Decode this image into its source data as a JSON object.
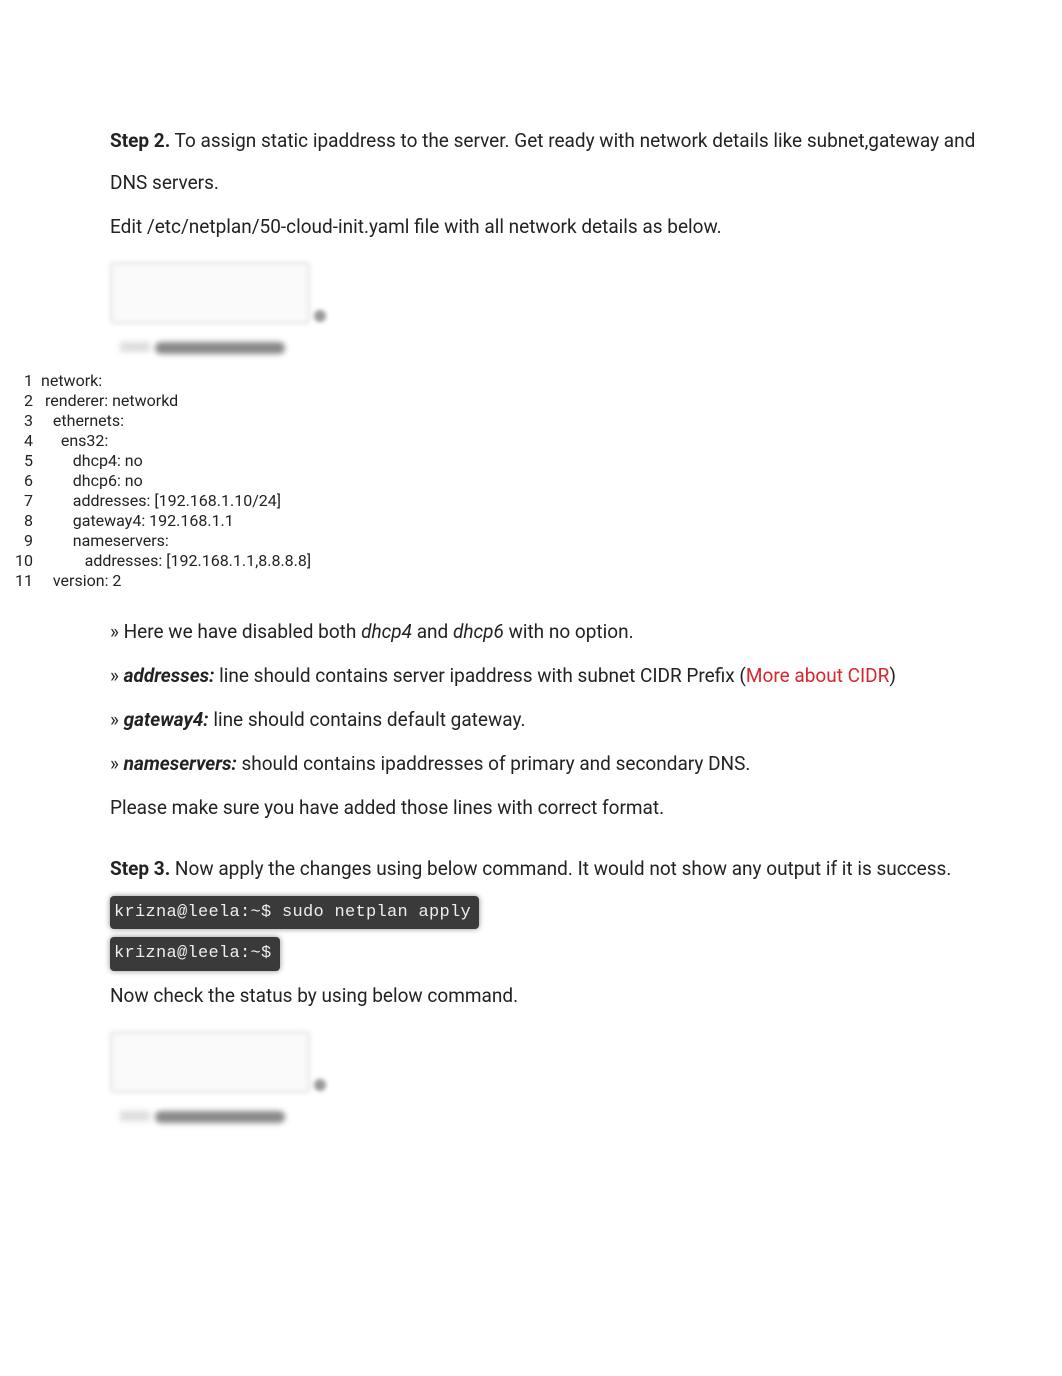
{
  "step2": {
    "label": "Step 2.",
    "para1": " To assign static ipaddress to the server. Get ready with network details like subnet,gateway and DNS servers.",
    "para2": "Edit /etc/netplan/50-cloud-init.yaml file with all network details as below."
  },
  "code": {
    "lines": [
      {
        "n": "1",
        "t": "network:"
      },
      {
        "n": "2",
        "t": " renderer: networkd"
      },
      {
        "n": "3",
        "t": "   ethernets:"
      },
      {
        "n": "4",
        "t": "     ens32:"
      },
      {
        "n": "5",
        "t": "        dhcp4: no"
      },
      {
        "n": "6",
        "t": "        dhcp6: no"
      },
      {
        "n": "7",
        "t": "        addresses: [192.168.1.10/24]"
      },
      {
        "n": "8",
        "t": "        gateway4: 192.168.1.1"
      },
      {
        "n": "9",
        "t": "        nameservers:"
      },
      {
        "n": "10",
        "t": "           addresses: [192.168.1.1,8.8.8.8]"
      },
      {
        "n": "11",
        "t": "   version: 2"
      }
    ]
  },
  "bullets": {
    "b1_pre": "» Here we have disabled both ",
    "b1_i1": "dhcp4",
    "b1_mid": " and ",
    "b1_i2": "dhcp6",
    "b1_post": " with no option.",
    "b2_pre": "» ",
    "b2_bold": "addresses:",
    "b2_post": " line should contains server ipaddress with subnet CIDR Prefix (",
    "b2_link": "More about CIDR",
    "b2_after": ")",
    "b3_pre": "» ",
    "b3_bold": "gateway4:",
    "b3_post": " line should contains default gateway.",
    "b4_pre": "» ",
    "b4_bold": "nameservers:",
    "b4_post": " should contains ipaddresses of primary and secondary DNS.",
    "b5": "Please make sure you have added those lines with correct format."
  },
  "step3": {
    "label": "Step 3.",
    "para1": " Now apply the changes using below command. It would not show any output if it is success.",
    "term1": "krizna@leela:~$ sudo netplan apply",
    "term2": "krizna@leela:~$",
    "para2": "Now check the status by using below command."
  }
}
